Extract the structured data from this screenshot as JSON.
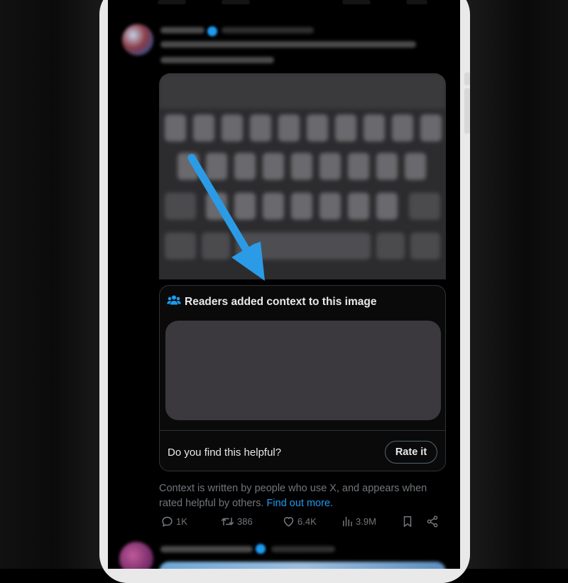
{
  "note": {
    "title": "Readers added context to this image",
    "helpful_prompt": "Do you find this helpful?",
    "rate_label": "Rate it"
  },
  "context_info": {
    "text": "Context is written by people who use X, and appears when rated helpful by others.",
    "link": "Find out more."
  },
  "actions": {
    "replies": "1K",
    "reposts": "386",
    "likes": "6.4K",
    "views": "3.9M"
  },
  "colors": {
    "accent": "#1d9bf0",
    "annotation_arrow": "#2b9be6",
    "muted_text": "#71767b",
    "border": "#2f3336"
  },
  "icons": [
    "people-icon",
    "reply-icon",
    "repost-icon",
    "like-icon",
    "views-icon",
    "bookmark-icon",
    "share-icon"
  ]
}
